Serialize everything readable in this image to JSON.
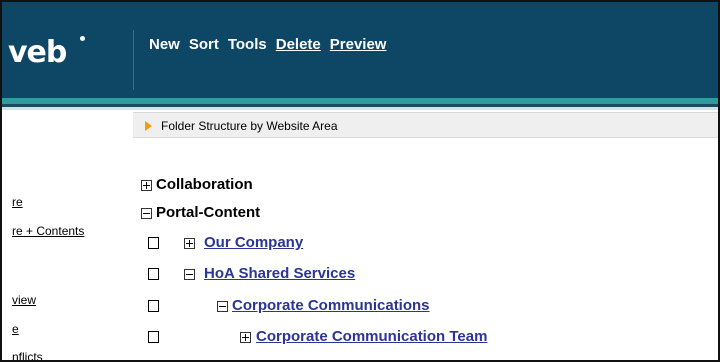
{
  "header": {
    "logo_text": "veb",
    "menu": {
      "new": "New",
      "sort": "Sort",
      "tools": "Tools",
      "delete": "Delete",
      "preview": "Preview"
    }
  },
  "subbar": {
    "text": "Folder Structure by Website Area"
  },
  "left_panel": {
    "links": [
      "re",
      "re + Contents",
      "view",
      "e",
      "nflicts"
    ]
  },
  "tree": {
    "nodes": [
      {
        "label": "Collaboration",
        "expander": "plus"
      },
      {
        "label": "Portal-Content",
        "expander": "minus"
      },
      {
        "label": "Our Company",
        "expander": "plus"
      },
      {
        "label": "HoA Shared Services",
        "expander": "minus"
      },
      {
        "label": "Corporate Communications",
        "expander": "minus"
      },
      {
        "label": "Corporate Communication Team",
        "expander": "plus"
      }
    ]
  },
  "colors": {
    "header_bg": "#0e4665",
    "accent_teal": "#2d9d9b",
    "link_blue": "#2a3595",
    "subbar_icon": "#f0a000"
  }
}
